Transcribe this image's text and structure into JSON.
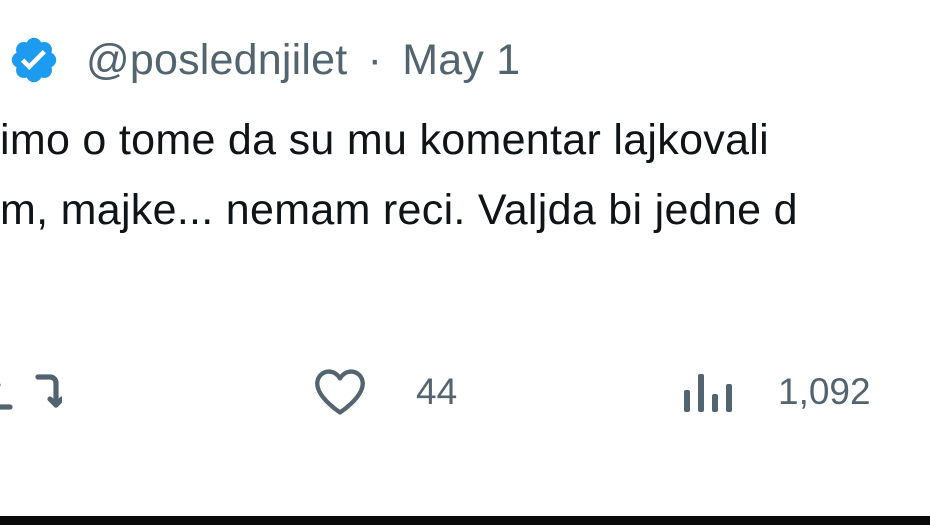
{
  "tweet": {
    "handle": "@poslednjilet",
    "separator": "·",
    "date": "May 1",
    "body_line_1": "imo o tome da su mu komentar lajkovali",
    "body_line_2": "m, majke... nemam reci. Valjda bi jedne d",
    "actions": {
      "retweet_icon": "retweet-icon",
      "like_icon": "heart-icon",
      "like_count": "44",
      "views_icon": "views-icon",
      "views_count": "1,092"
    },
    "colors": {
      "verified_badge": "#1d9bf0",
      "text": "#0f1419",
      "muted": "#536471"
    }
  }
}
